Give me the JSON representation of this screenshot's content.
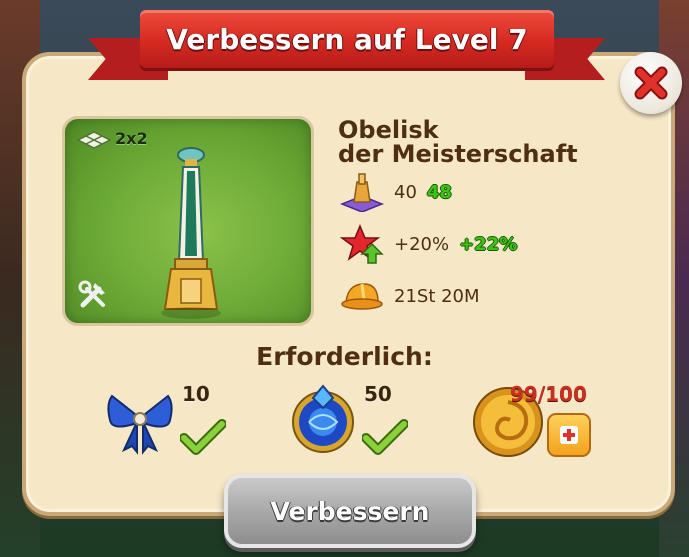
{
  "dialog": {
    "title": "Verbessern auf Level 7",
    "close_icon": "close-x-icon"
  },
  "building": {
    "size": "2x2",
    "name_line1": "Obelisk",
    "name_line2": "der Meisterschaft",
    "tools_icon": "hammer-wrench-icon"
  },
  "stats": [
    {
      "icon": "population-pedestal-icon",
      "old": "40",
      "new": "48"
    },
    {
      "icon": "star-up-arrow-icon",
      "old": "+20%",
      "new": "+22%"
    },
    {
      "icon": "hard-hat-icon",
      "old": "21St 20M",
      "new": ""
    }
  ],
  "requirements": {
    "label": "Erforderlich:",
    "items": [
      {
        "icon": "blue-bow-icon",
        "count": "10",
        "status": "ok"
      },
      {
        "icon": "blue-crystal-orb-icon",
        "count": "50",
        "status": "ok"
      },
      {
        "icon": "gold-coin-icon",
        "count": "99/100",
        "status": "missing"
      }
    ]
  },
  "action": {
    "upgrade_label": "Verbessern"
  },
  "colors": {
    "ribbon": "#d42a22",
    "panel": "#f6e7c6",
    "new_value": "#3fc316",
    "missing": "#c8311f"
  }
}
